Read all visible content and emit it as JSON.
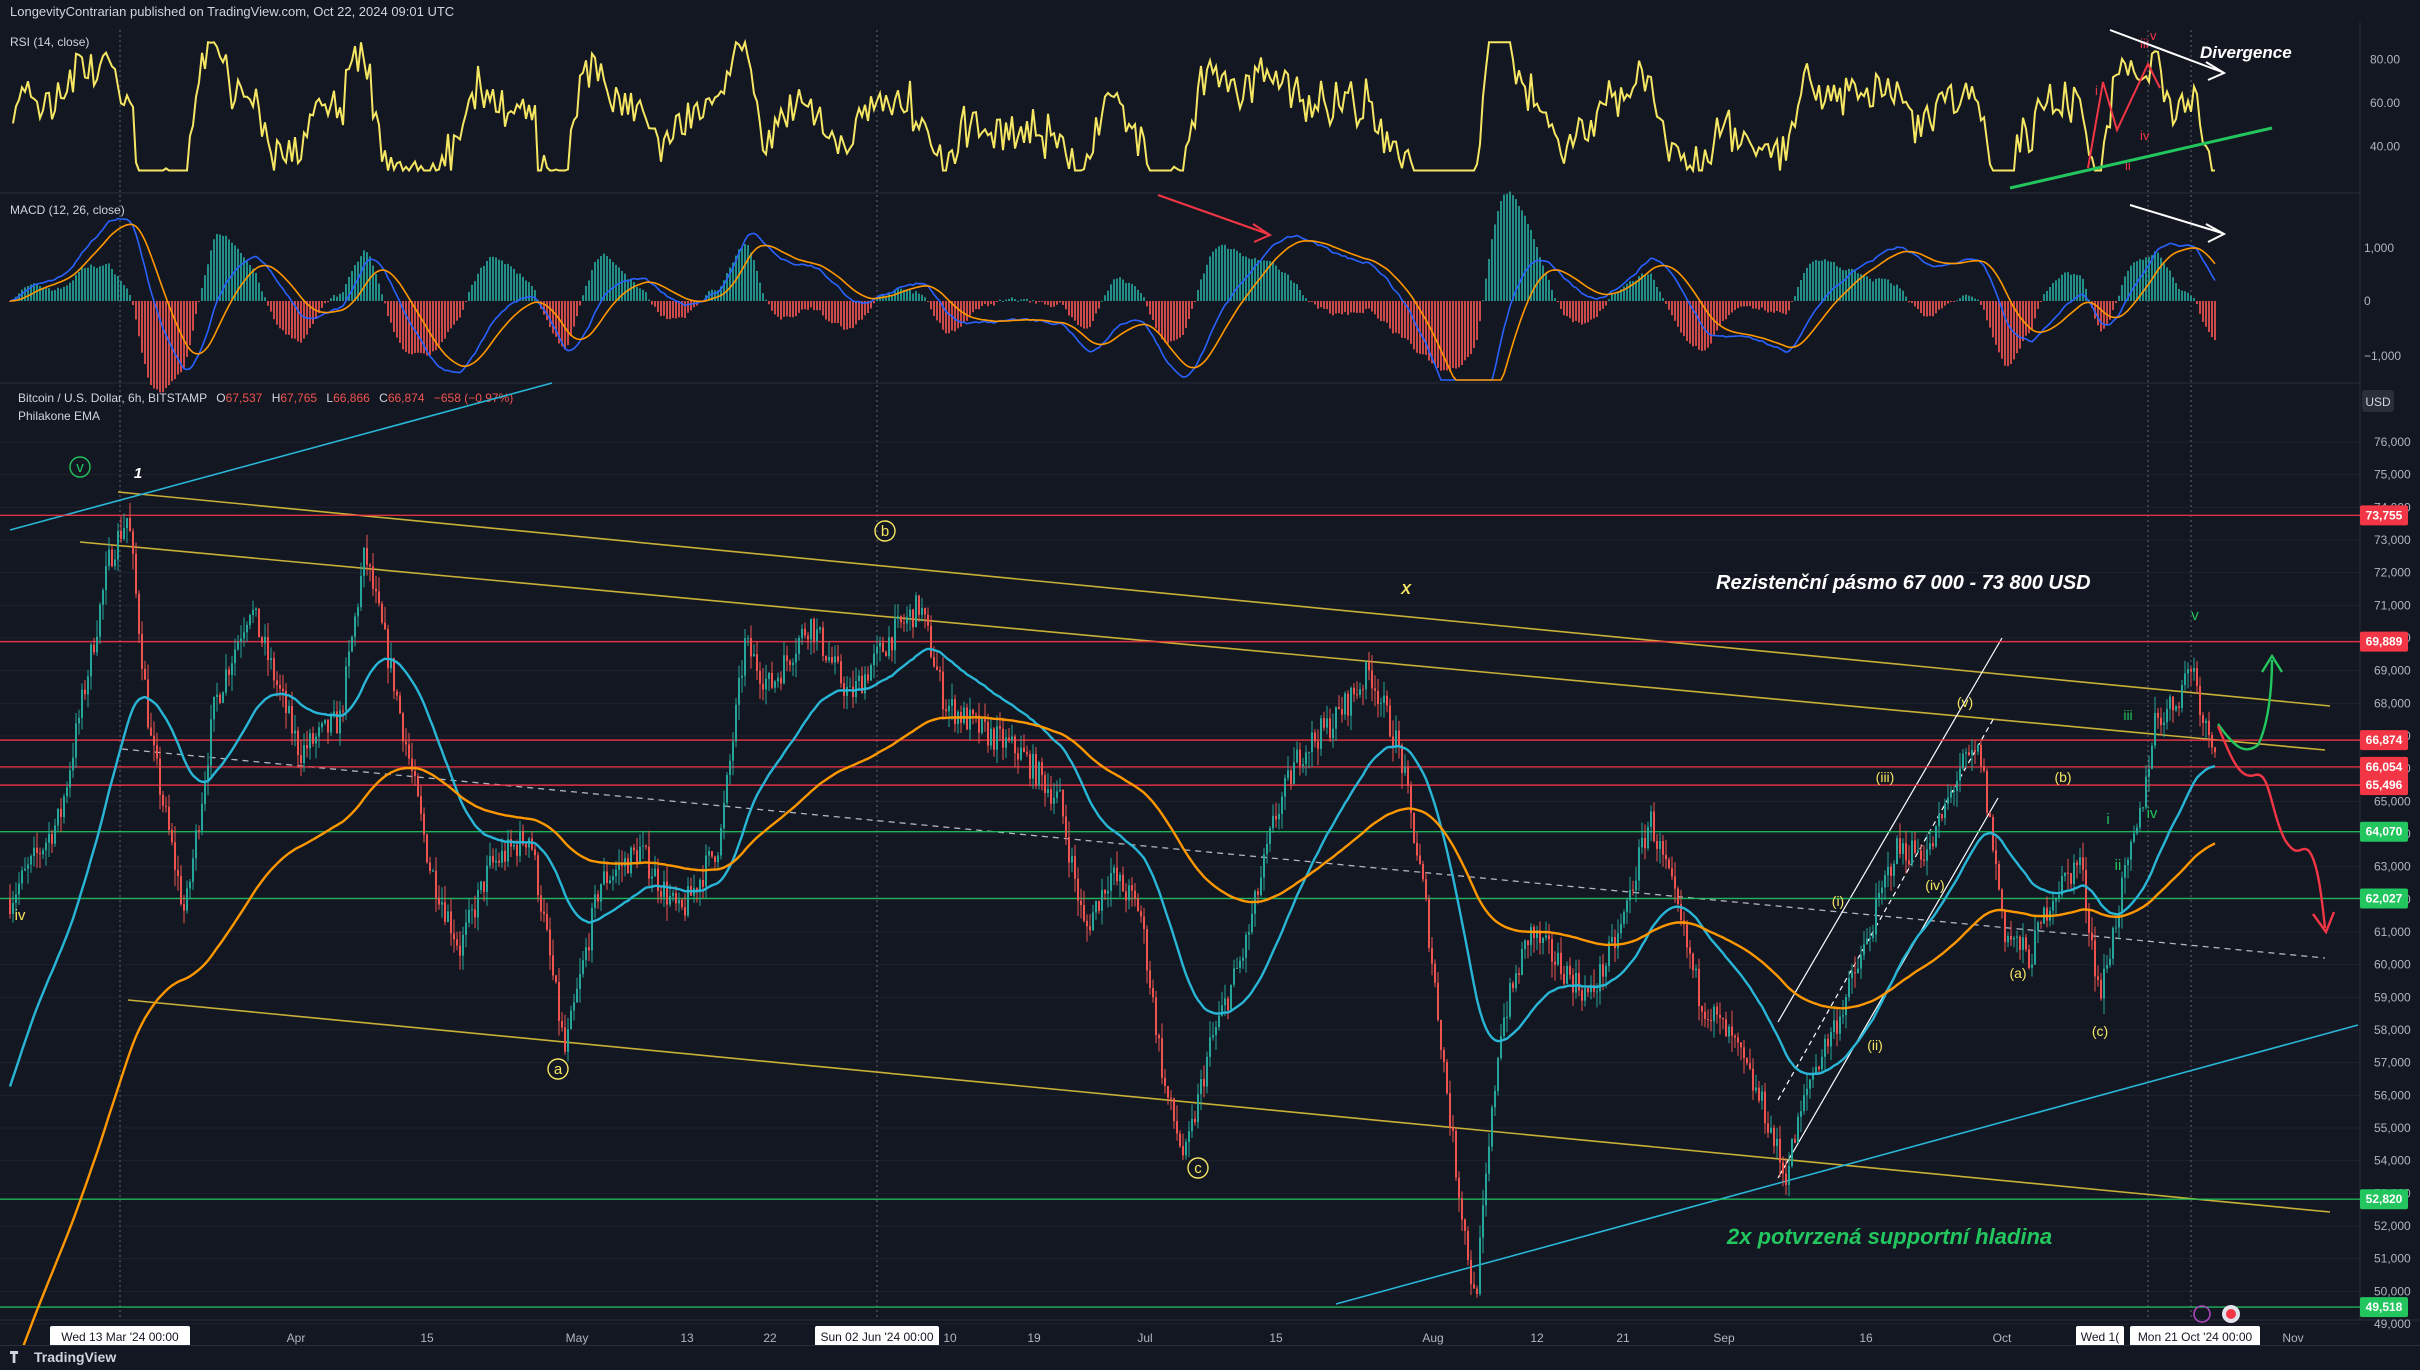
{
  "header": {
    "publisher_note": "LongevityContrarian published on TradingView.com, Oct 22, 2024 09:01 UTC"
  },
  "footer": {
    "brand": "TradingView"
  },
  "panes": {
    "rsi": {
      "label": "RSI (14, close)",
      "ticks": [
        "80.00",
        "60.00",
        "40.00"
      ],
      "divergence": "Divergence",
      "wave_labels": [
        "i",
        "ii",
        "iii",
        "iv",
        "v"
      ]
    },
    "macd": {
      "label": "MACD (12, 26, close)",
      "ticks": [
        "1,000",
        "0",
        "−1,000"
      ]
    },
    "price": {
      "title_line": "Bitcoin / U.S. Dollar, 6h, BITSTAMP",
      "ohlc": {
        "o_label": "O",
        "o": "67,537",
        "h_label": "H",
        "h": "67,765",
        "l_label": "L",
        "l": "66,866",
        "c_label": "C",
        "c": "66,874",
        "change": "−658 (−0.97%)"
      },
      "indicator": "Philakone EMA",
      "currency": "USD"
    }
  },
  "colors": {
    "background": "#131722",
    "grid": "#1e222d",
    "rsi": "#f5e663",
    "macd_line": "#2962ff",
    "signal_line": "#ff9800",
    "hist_up": "#26a69a",
    "hist_down": "#ef5350",
    "ema_fast": "#29b6d6",
    "ema_slow": "#ff9800",
    "resistance": "#f23645",
    "support": "#22c55e",
    "channel": "#c9b037"
  },
  "chart_data": {
    "type": "candlestick",
    "symbol": "Bitcoin / U.S. Dollar",
    "timeframe": "6h",
    "exchange": "BITSTAMP",
    "y_range": [
      49000,
      76000
    ],
    "y_ticks": [
      "76,000",
      "75,000",
      "74,000",
      "73,000",
      "72,000",
      "71,000",
      "70,000",
      "69,000",
      "68,000",
      "67,000",
      "66,000",
      "65,000",
      "64,000",
      "63,000",
      "62,000",
      "61,000",
      "60,000",
      "59,000",
      "58,000",
      "57,000",
      "56,000",
      "55,000",
      "54,000",
      "53,000",
      "52,000",
      "51,000",
      "50,000",
      "49,000"
    ],
    "x_labels": [
      "Apr",
      "15",
      "May",
      "13",
      "22",
      "10",
      "19",
      "Jul",
      "15",
      "Aug",
      "12",
      "21",
      "Sep",
      "16",
      "Oct",
      "Nov"
    ],
    "x_highlight_labels": [
      "Wed 13 Mar '24  00:00",
      "Sun 02 Jun '24  00:00",
      "Wed 1(",
      "Mon 21 Oct '24  00:00"
    ],
    "price_levels": [
      {
        "value": 73755,
        "label": "73,755",
        "color": "#f23645"
      },
      {
        "value": 69889,
        "label": "69,889",
        "color": "#f23645"
      },
      {
        "value": 66874,
        "label": "66,874",
        "color": "#f23645"
      },
      {
        "value": 66054,
        "label": "66,054",
        "color": "#f23645"
      },
      {
        "value": 65496,
        "label": "65,496",
        "color": "#f23645"
      },
      {
        "value": 64070,
        "label": "64,070",
        "color": "#22c55e"
      },
      {
        "value": 62027,
        "label": "62,027",
        "color": "#22c55e"
      },
      {
        "value": 52820,
        "label": "52,820",
        "color": "#22c55e"
      },
      {
        "value": 49518,
        "label": "49,518",
        "color": "#22c55e"
      }
    ],
    "annotations": [
      {
        "text": "Rezistenční pásmo 67 000 - 73 800 USD",
        "color": "#ffffff"
      },
      {
        "text": "2x potvrzená supportní hladina",
        "color": "#22c55e"
      }
    ],
    "wave_labels": [
      "v",
      "1",
      "b",
      "X",
      "a",
      "c",
      "iv",
      "(i)",
      "(ii)",
      "(iii)",
      "(iv)",
      "(v)",
      "(a)",
      "(b)",
      "(c)",
      "i",
      "ii",
      "iii",
      "iv",
      "v"
    ]
  }
}
